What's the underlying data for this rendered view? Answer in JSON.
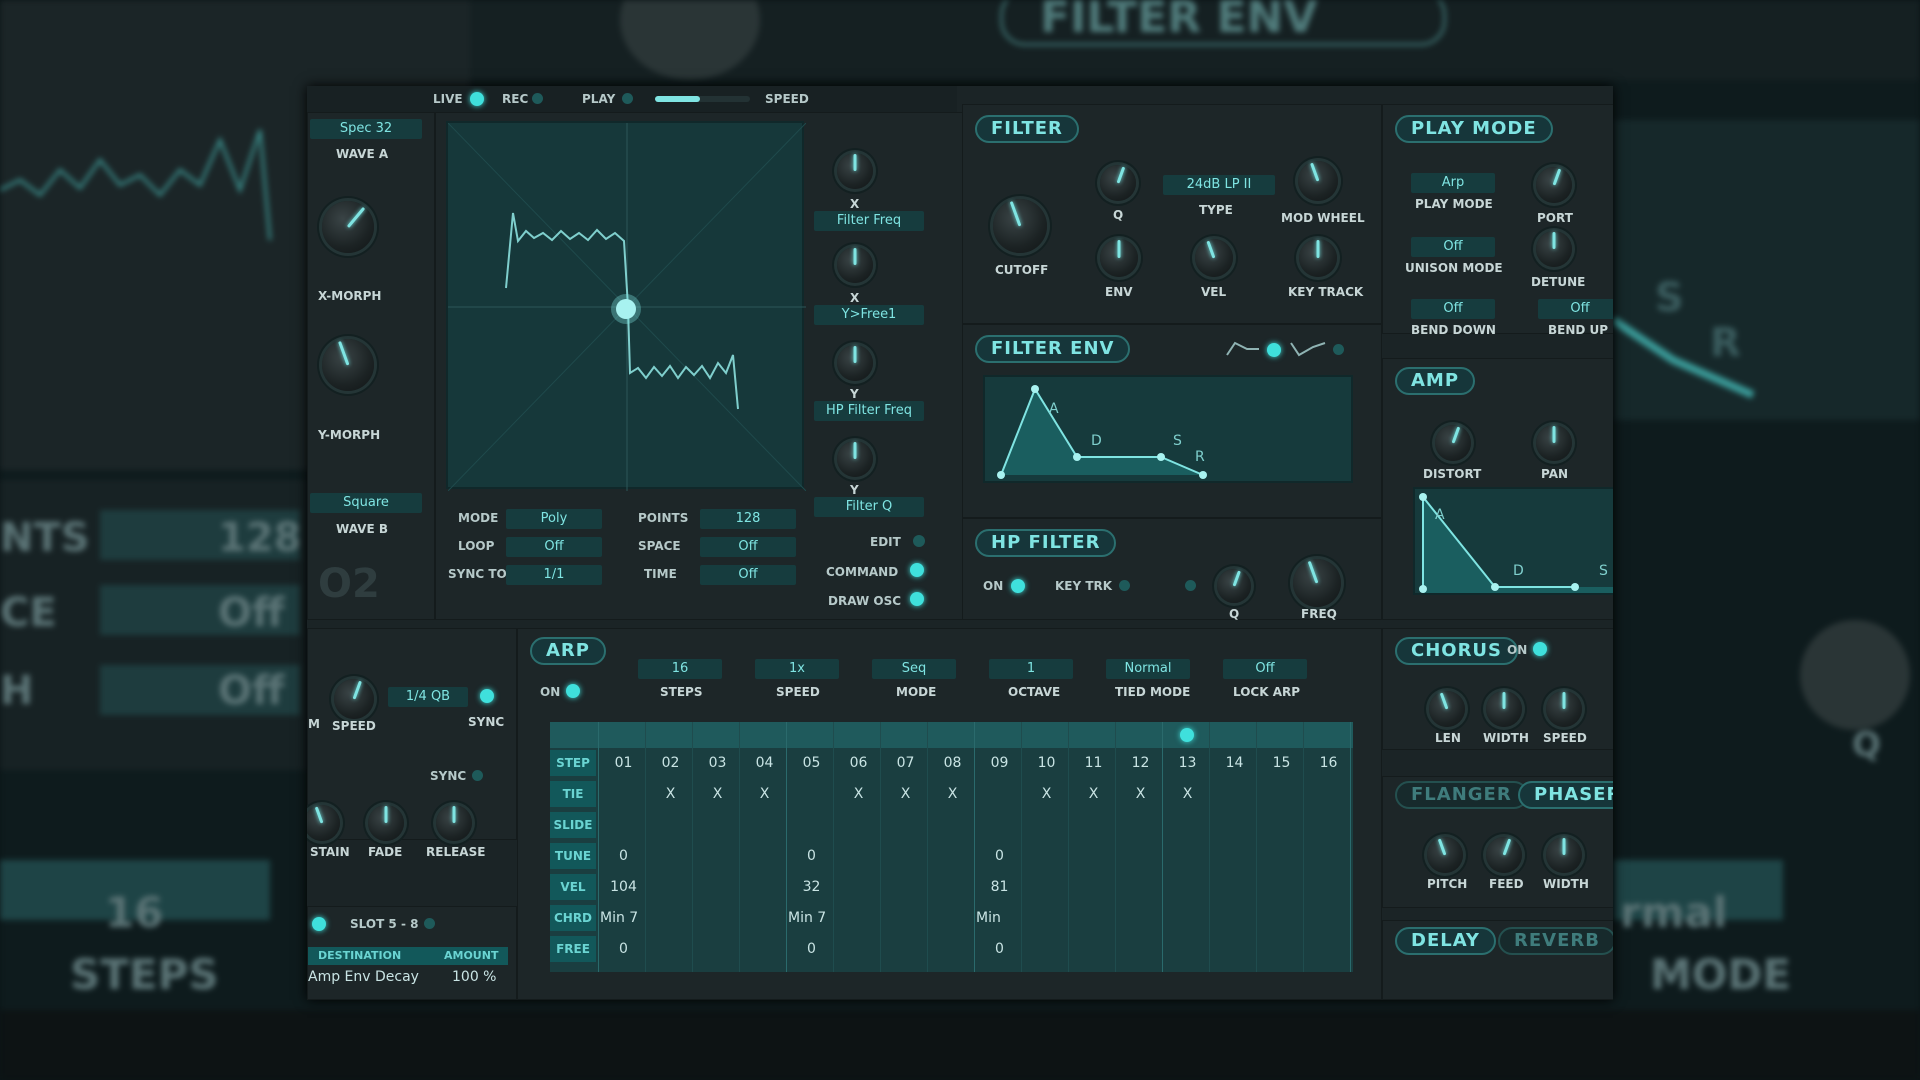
{
  "background": {
    "bg_texts": [
      "NTS",
      "128",
      "CE",
      "Off",
      "H",
      "Off",
      "16",
      "STEPS",
      "rmal",
      "MODE",
      "Q",
      "R",
      "S",
      "FILTER ENV"
    ]
  },
  "topbar": {
    "live": "LIVE",
    "rec": "REC",
    "play": "PLAY",
    "speed": "SPEED"
  },
  "osc": {
    "wave_a_value": "Spec 32",
    "wave_a_label": "WAVE A",
    "x_morph": "X-MORPH",
    "y_morph": "Y-MORPH",
    "wave_b_value": "Square",
    "wave_b_label": "WAVE B",
    "osc_number": "O2"
  },
  "xy": {
    "mode_label": "MODE",
    "mode_value": "Poly",
    "points_label": "POINTS",
    "points_value": "128",
    "loop_label": "LOOP",
    "loop_value": "Off",
    "space_label": "SPACE",
    "space_value": "Off",
    "sync_label": "SYNC TO",
    "sync_value": "1/1",
    "time_label": "TIME",
    "time_value": "Off"
  },
  "mod": {
    "x1_label": "X",
    "x1_target": "Filter Freq",
    "x2_label": "X",
    "x2_target": "Y>Free1",
    "y1_label": "Y",
    "y1_target": "HP Filter Freq",
    "y2_label": "Y",
    "y2_target": "Filter Q",
    "edit": "EDIT",
    "command": "COMMAND",
    "draw_osc": "DRAW OSC"
  },
  "filter": {
    "title": "FILTER",
    "q": "Q",
    "type_value": "24dB LP II",
    "type_label": "TYPE",
    "mod_wheel": "MOD WHEEL",
    "cutoff": "CUTOFF",
    "env": "ENV",
    "vel": "VEL",
    "key_track": "KEY TRACK"
  },
  "filter_env": {
    "title": "FILTER ENV",
    "a": "A",
    "d": "D",
    "s": "S",
    "r": "R"
  },
  "hp_filter": {
    "title": "HP FILTER",
    "on": "ON",
    "key_trk": "KEY TRK",
    "q": "Q",
    "freq": "FREQ"
  },
  "play_mode": {
    "title": "PLAY MODE",
    "play_mode_value": "Arp",
    "play_mode_label": "PLAY MODE",
    "port": "PORT",
    "unison_value": "Off",
    "unison_label": "UNISON MODE",
    "detune": "DETUNE",
    "bend_down_value": "Off",
    "bend_down_label": "BEND DOWN",
    "bend_up_value": "Off",
    "bend_up_label": "BEND UP"
  },
  "amp": {
    "title": "AMP",
    "distort": "DISTORT",
    "pan": "PAN",
    "a": "A",
    "d": "D",
    "s": "S"
  },
  "lfo": {
    "speed": "SPEED",
    "rate_value": "1/4 QB",
    "sync": "SYNC",
    "m_label": "M",
    "sync2": "SYNC",
    "sustain": "STAIN",
    "fade": "FADE",
    "release": "RELEASE"
  },
  "slots": {
    "label": "SLOT 5 - 8",
    "destination": "DESTINATION",
    "amount": "AMOUNT",
    "row_destination": "Amp Env Decay",
    "row_amount": "100 %"
  },
  "arp": {
    "title": "ARP",
    "on": "ON",
    "steps_value": "16",
    "steps_label": "STEPS",
    "speed_value": "1x",
    "speed_label": "SPEED",
    "mode_value": "Seq",
    "mode_label": "MODE",
    "octave_value": "1",
    "octave_label": "OCTAVE",
    "tied_value": "Normal",
    "tied_label": "TIED MODE",
    "lock_value": "Off",
    "lock_label": "LOCK ARP",
    "row_labels": [
      "STEP",
      "TIE",
      "SLIDE",
      "TUNE",
      "VEL",
      "CHRD",
      "FREE"
    ],
    "steps": [
      "01",
      "02",
      "03",
      "04",
      "05",
      "06",
      "07",
      "08",
      "09",
      "10",
      "11",
      "12",
      "13",
      "14",
      "15",
      "16"
    ],
    "tie": [
      "",
      "X",
      "X",
      "X",
      "",
      "X",
      "X",
      "X",
      "",
      "X",
      "X",
      "X",
      "X",
      "",
      "",
      ""
    ],
    "tune": [
      "0",
      "",
      "",
      "",
      "0",
      "",
      "",
      "",
      "0",
      "",
      "",
      "",
      "",
      "",
      "",
      ""
    ],
    "vel": [
      "104",
      "",
      "",
      "",
      "32",
      "",
      "",
      "",
      "81",
      "",
      "",
      "",
      "",
      "",
      "",
      ""
    ],
    "chord": [
      "Min 7",
      "",
      "",
      "",
      "Min 7",
      "",
      "",
      "",
      "Min",
      "",
      "",
      "",
      "",
      "",
      "",
      ""
    ],
    "free": [
      "0",
      "",
      "",
      "",
      "0",
      "",
      "",
      "",
      "0",
      "",
      "",
      "",
      "",
      "",
      "",
      ""
    ]
  },
  "chorus": {
    "title": "CHORUS",
    "on": "ON",
    "len": "LEN",
    "width": "WIDTH",
    "speed": "SPEED"
  },
  "flanger": {
    "title": "FLANGER",
    "phaser": "PHASER",
    "pitch": "PITCH",
    "feed": "FEED",
    "width": "WIDTH"
  },
  "delay": {
    "title": "DELAY",
    "reverb": "REVERB"
  }
}
